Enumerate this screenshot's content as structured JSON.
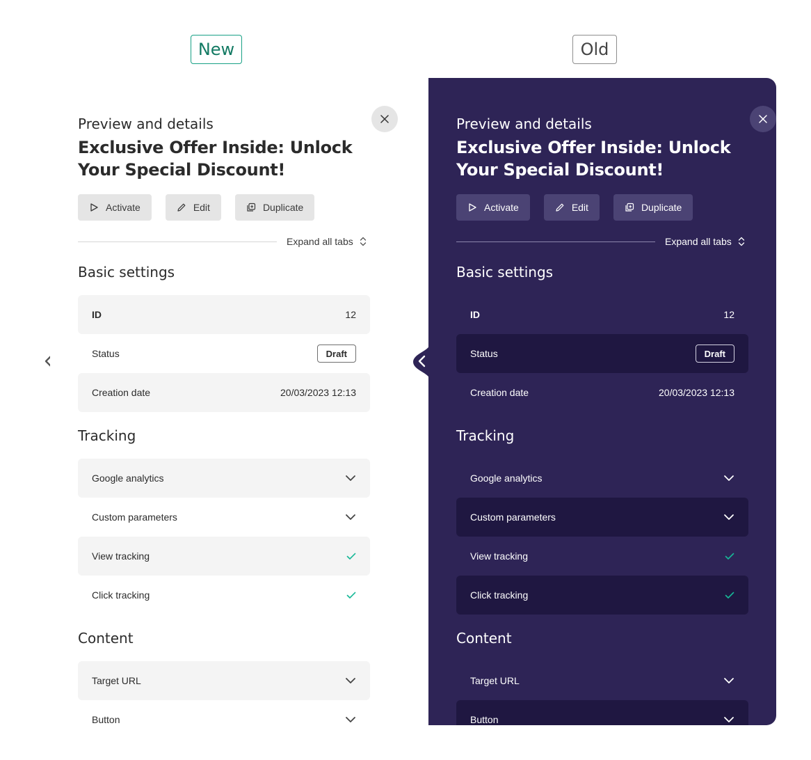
{
  "tags": {
    "new": "New",
    "old": "Old"
  },
  "panel": {
    "eyebrow": "Preview and details",
    "title": "Exclusive Offer Inside: Unlock Your Special Discount!",
    "actions": {
      "activate": "Activate",
      "edit": "Edit",
      "duplicate": "Duplicate"
    },
    "expand_all": "Expand all tabs",
    "basic_settings": {
      "heading": "Basic settings",
      "id_label": "ID",
      "id_value": "12",
      "status_label": "Status",
      "status_value": "Draft",
      "creation_label": "Creation date",
      "creation_value": "20/03/2023 12:13"
    },
    "tracking": {
      "heading": "Tracking",
      "google_analytics": "Google analytics",
      "custom_parameters": "Custom parameters",
      "view_tracking": "View tracking",
      "click_tracking": "Click tracking"
    },
    "content": {
      "heading": "Content",
      "target_url": "Target URL",
      "button": "Button"
    }
  },
  "colors": {
    "old_panel_bg": "#2e2456",
    "old_row_shade": "#1f1741",
    "new_row_shade": "#f4f4f4",
    "check_green": "#17b897",
    "new_tag_green": "#17a085"
  },
  "icons": [
    "close-icon",
    "play-icon",
    "pencil-icon",
    "duplicate-icon",
    "sort-icon",
    "chevron-down-icon",
    "check-icon",
    "chevron-left-icon"
  ]
}
